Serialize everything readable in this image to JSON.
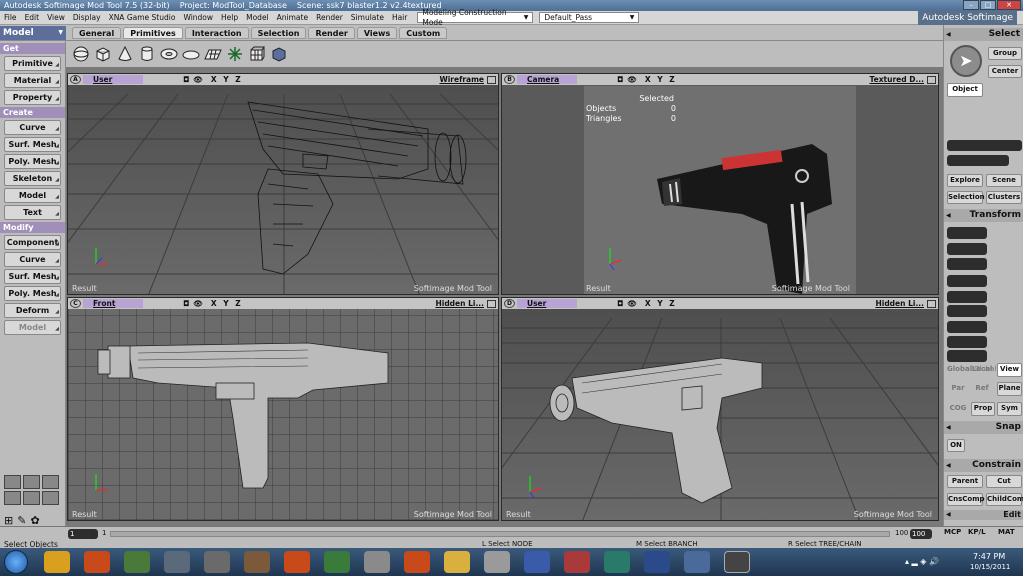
{
  "window": {
    "app_title": "Autodesk Softimage Mod Tool 7.5 (32-bit)",
    "project": "Project: ModTool_Database",
    "scene": "Scene: ssk7 blaster1.2 v2.4textured"
  },
  "menubar": {
    "items": [
      "File",
      "Edit",
      "View",
      "Display",
      "XNA Game Studio",
      "Window",
      "Help",
      "Model",
      "Animate",
      "Render",
      "Simulate",
      "Hair"
    ],
    "construction_mode": "Modeling Construction Mode",
    "pass": "Default_Pass",
    "brand": "Autodesk Softimage"
  },
  "toolbar": {
    "mode": "Model",
    "tabs": [
      "General",
      "Primitives",
      "Interaction",
      "Selection",
      "Render",
      "Views",
      "Custom"
    ],
    "active_tab": "Primitives"
  },
  "left_panel": {
    "get_label": "Get",
    "get_items": [
      "Primitive",
      "Material",
      "Property"
    ],
    "create_label": "Create",
    "create_items": [
      "Curve",
      "Surf. Mesh",
      "Poly. Mesh",
      "Skeleton",
      "Model",
      "Text"
    ],
    "modify_label": "Modify",
    "modify_items": [
      "Component",
      "Curve",
      "Surf. Mesh",
      "Poly. Mesh",
      "Deform",
      "Model"
    ]
  },
  "viewports": {
    "a": {
      "letter": "A",
      "camera": "User",
      "axes": "X Y Z",
      "mode": "Wireframe",
      "result": "Result",
      "watermark": "Softimage Mod Tool"
    },
    "b": {
      "letter": "B",
      "camera": "Camera",
      "axes": "X Y Z",
      "mode": "Textured D...",
      "result": "Result",
      "watermark": "Softimage Mod Tool",
      "info_title": "Selected",
      "objects_label": "Objects",
      "objects_value": "0",
      "triangles_label": "Triangles",
      "triangles_value": "0"
    },
    "c": {
      "letter": "C",
      "camera": "Front",
      "axes": "X Y Z",
      "mode": "Hidden Li...",
      "result": "Result",
      "watermark": "Softimage Mod Tool"
    },
    "d": {
      "letter": "D",
      "camera": "User",
      "axes": "X Y Z",
      "mode": "Hidden Li...",
      "result": "Result",
      "watermark": "Softimage Mod Tool"
    }
  },
  "right_panel": {
    "select_label": "Select",
    "group": "Group",
    "center": "Center",
    "object": "Object",
    "explore": "Explore",
    "scene": "Scene",
    "selection": "Selection",
    "clusters": "Clusters",
    "transform_label": "Transform",
    "global": "Global",
    "local": "Local",
    "view": "View",
    "par": "Par",
    "ref": "Ref",
    "plane": "Plane",
    "cog": "COG",
    "prop": "Prop",
    "sym": "Sym",
    "snap_label": "Snap",
    "on": "ON",
    "constrain_label": "Constrain",
    "parent": "Parent",
    "cut": "Cut",
    "cnscomp": "CnsComp",
    "childcomp": "ChildComp",
    "edit_label": "Edit",
    "mcp": "MCP",
    "kpl": "KP/L",
    "mat": "MAT"
  },
  "timeline": {
    "start": "1",
    "current": "1",
    "end": "100",
    "end2": "100"
  },
  "status": {
    "hint": "Select Objects",
    "l": "Select NODE",
    "m": "Select BRANCH",
    "r": "Select TREE/CHAIN"
  },
  "taskbar": {
    "time": "7:47 PM",
    "date": "10/15/2011"
  }
}
